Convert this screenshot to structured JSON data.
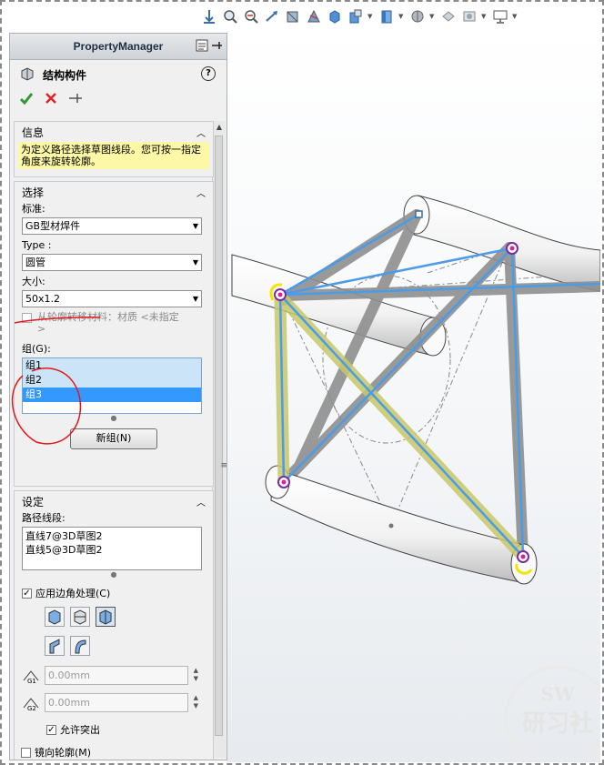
{
  "panel": {
    "header_title": "PropertyManager",
    "feature_name": "结构构件",
    "help_label": "?",
    "ok_icon": "check-icon",
    "cancel_icon": "x-icon",
    "pin_icon": "pushpin-icon"
  },
  "info": {
    "title": "信息",
    "message": "为定义路径选择草图线段。您可按一指定角度来旋转轮廓。"
  },
  "selection": {
    "title": "选择",
    "standard_label": "标准:",
    "standard_value": "GB型材焊件",
    "type_label": "Type :",
    "type_value": "圆管",
    "size_label": "大小:",
    "size_value": "50x1.2",
    "transfer_label": "从轮廓转移材料：材质 <未指定>",
    "groups_label": "组(G):",
    "groups": [
      "组1",
      "组2",
      "组3"
    ],
    "selected_group": "组3",
    "new_group_button": "新组(N)"
  },
  "settings": {
    "title": "设定",
    "path_label": "路径线段:",
    "path_segments": [
      "直线7@3D草图2",
      "直线5@3D草图2"
    ],
    "corner_label": "应用边角处理(C)",
    "gap1_label": "G1",
    "gap1_value": "0.00mm",
    "gap2_label": "G2",
    "gap2_value": "0.00mm",
    "allow_protrusion_label": "允许突出",
    "mirror_label": "镜向轮廓(M)"
  },
  "watermark": {
    "line1": "SW",
    "line2": "研习社"
  },
  "colors": {
    "accent_blue": "#3399ff",
    "info_yellow": "#fdf8a6",
    "annotation_red": "#e01818",
    "sketch_line": "#4a9be8",
    "highlight_yellow": "#c8c86a"
  }
}
